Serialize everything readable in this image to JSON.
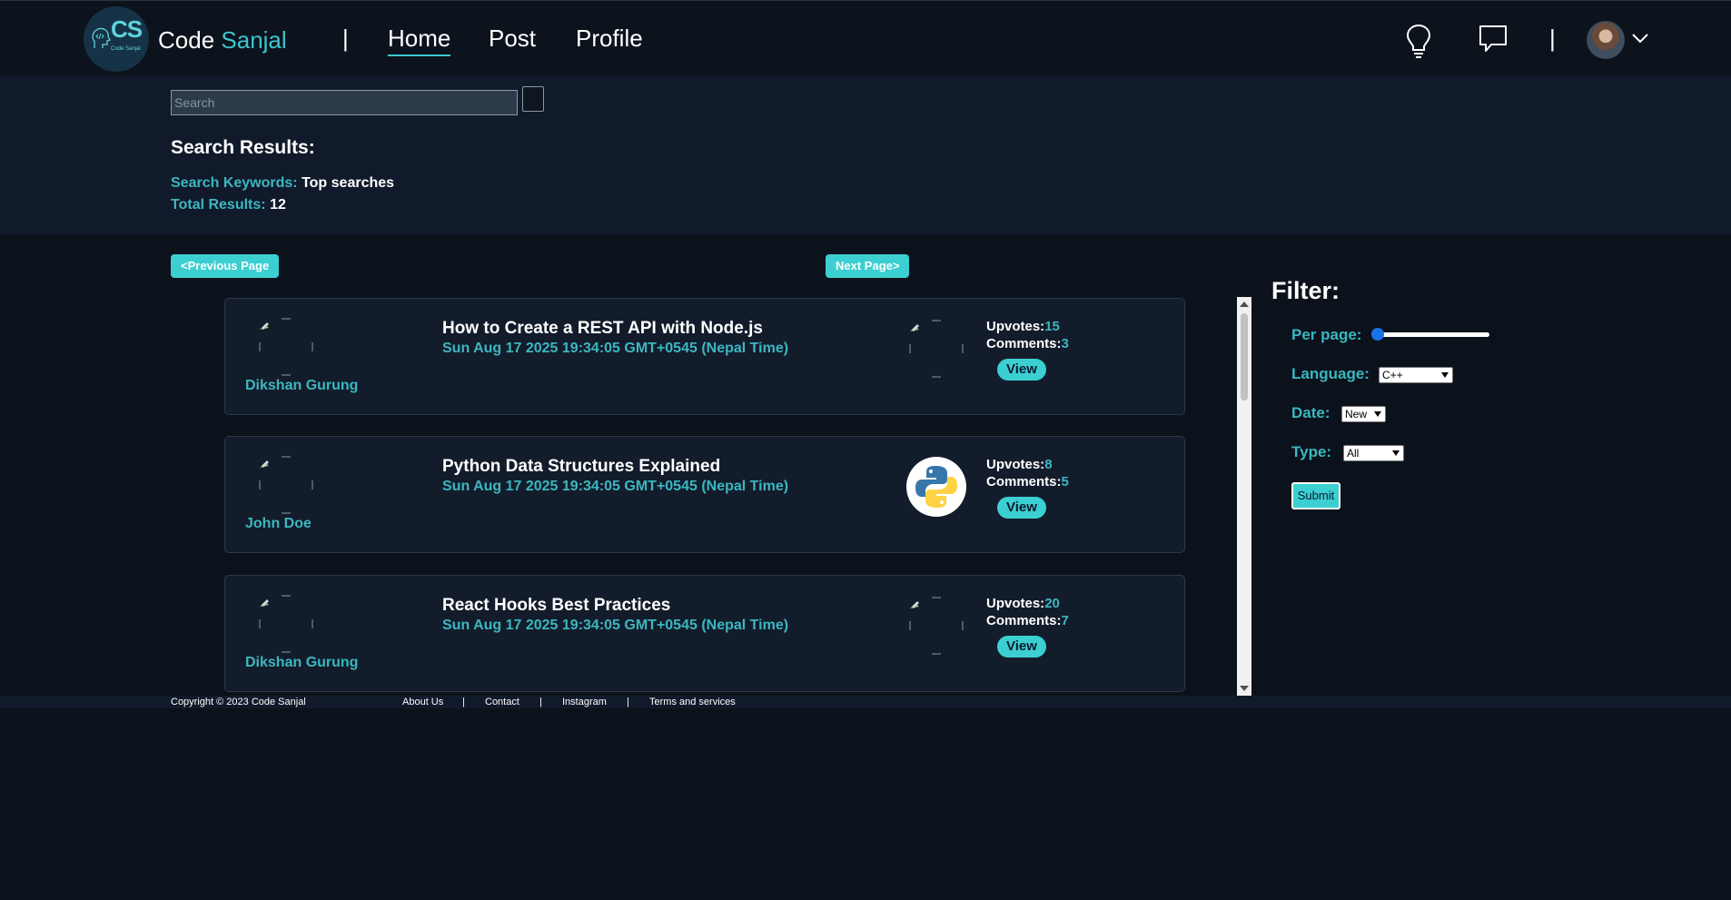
{
  "brand": {
    "logo_initials": "CS",
    "logo_subtitle": "Code Sanjal",
    "name_part1": "Code",
    "name_part2": "Sanjal"
  },
  "nav": {
    "separator": "|",
    "links": [
      {
        "label": "Home",
        "active": true
      },
      {
        "label": "Post",
        "active": false
      },
      {
        "label": "Profile",
        "active": false
      }
    ],
    "icons": [
      "lightbulb-icon",
      "chat-bubble-icon",
      "chevron-down-icon"
    ]
  },
  "search": {
    "placeholder": "Search",
    "results_title": "Search Results:",
    "keywords_label": "Search Keywords:",
    "keywords_value": "Top searches",
    "total_label": "Total Results:",
    "total_value": "12"
  },
  "pagination": {
    "prev_label": "<Previous Page",
    "next_label": "Next Page>"
  },
  "posts": [
    {
      "author": "Dikshan Gurung",
      "title": "How to Create a REST API with Node.js",
      "date": "Sun Aug 17 2025 19:34:05 GMT+0545 (Nepal Time)",
      "upvotes_label": "Upvotes:",
      "upvotes": "15",
      "comments_label": "Comments:",
      "comments": "3",
      "view_label": "View",
      "language_icon": "broken-image-icon"
    },
    {
      "author": "John Doe",
      "title": "Python Data Structures Explained",
      "date": "Sun Aug 17 2025 19:34:05 GMT+0545 (Nepal Time)",
      "upvotes_label": "Upvotes:",
      "upvotes": "8",
      "comments_label": "Comments:",
      "comments": "5",
      "view_label": "View",
      "language_icon": "python-logo-icon"
    },
    {
      "author": "Dikshan Gurung",
      "title": "React Hooks Best Practices",
      "date": "Sun Aug 17 2025 19:34:05 GMT+0545 (Nepal Time)",
      "upvotes_label": "Upvotes:",
      "upvotes": "20",
      "comments_label": "Comments:",
      "comments": "7",
      "view_label": "View",
      "language_icon": "broken-image-icon"
    }
  ],
  "filter": {
    "title": "Filter:",
    "per_page_label": "Per page:",
    "per_page_value": 0,
    "language_label": "Language:",
    "language_value": "C++",
    "date_label": "Date:",
    "date_value": "New",
    "type_label": "Type:",
    "type_value": "All",
    "submit_label": "Submit"
  },
  "footer": {
    "copyright": "Copyright © 2023 Code Sanjal",
    "links": [
      "About Us",
      "Contact",
      "Instagram",
      "Terms and services"
    ],
    "separator": "|"
  },
  "colors": {
    "background": "#0b121b",
    "navbar": "#0c131c",
    "band": "#111a2b",
    "accent": "#3bc6cf",
    "button": "#3ccfd2",
    "card": "#131c2b"
  }
}
